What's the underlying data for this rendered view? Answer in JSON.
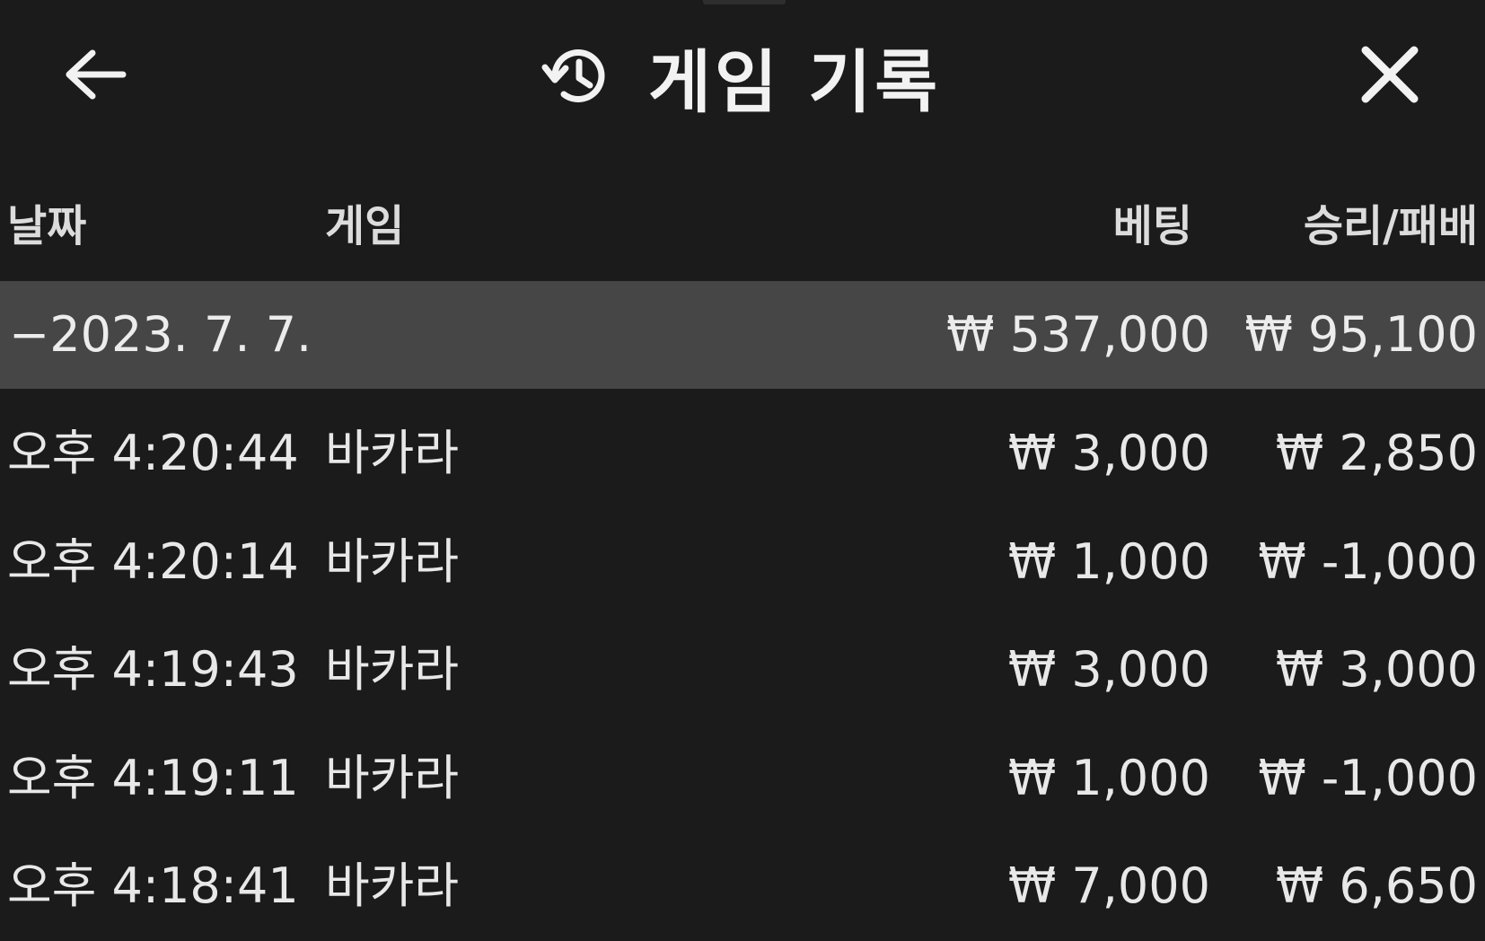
{
  "header": {
    "title": "게임 기록",
    "back_icon": "arrow-left-icon",
    "history_icon": "history-icon",
    "close_icon": "close-icon"
  },
  "columns": {
    "date": "날짜",
    "game": "게임",
    "bet": "베팅",
    "result": "승리/패배"
  },
  "summary": {
    "date": "−2023. 7. 7.",
    "bet": "₩ 537,000",
    "result": "₩ 95,100"
  },
  "rows": [
    {
      "time": "오후 4:20:44",
      "game": "바카라",
      "bet": "₩ 3,000",
      "result": "₩ 2,850"
    },
    {
      "time": "오후 4:20:14",
      "game": "바카라",
      "bet": "₩ 1,000",
      "result": "₩ -1,000"
    },
    {
      "time": "오후 4:19:43",
      "game": "바카라",
      "bet": "₩ 3,000",
      "result": "₩ 3,000"
    },
    {
      "time": "오후 4:19:11",
      "game": "바카라",
      "bet": "₩ 1,000",
      "result": "₩ -1,000"
    },
    {
      "time": "오후 4:18:41",
      "game": "바카라",
      "bet": "₩ 7,000",
      "result": "₩ 6,650"
    }
  ],
  "colors": {
    "background": "#1b1b1b",
    "summary_background": "#464646",
    "text": "#eaeaea"
  }
}
